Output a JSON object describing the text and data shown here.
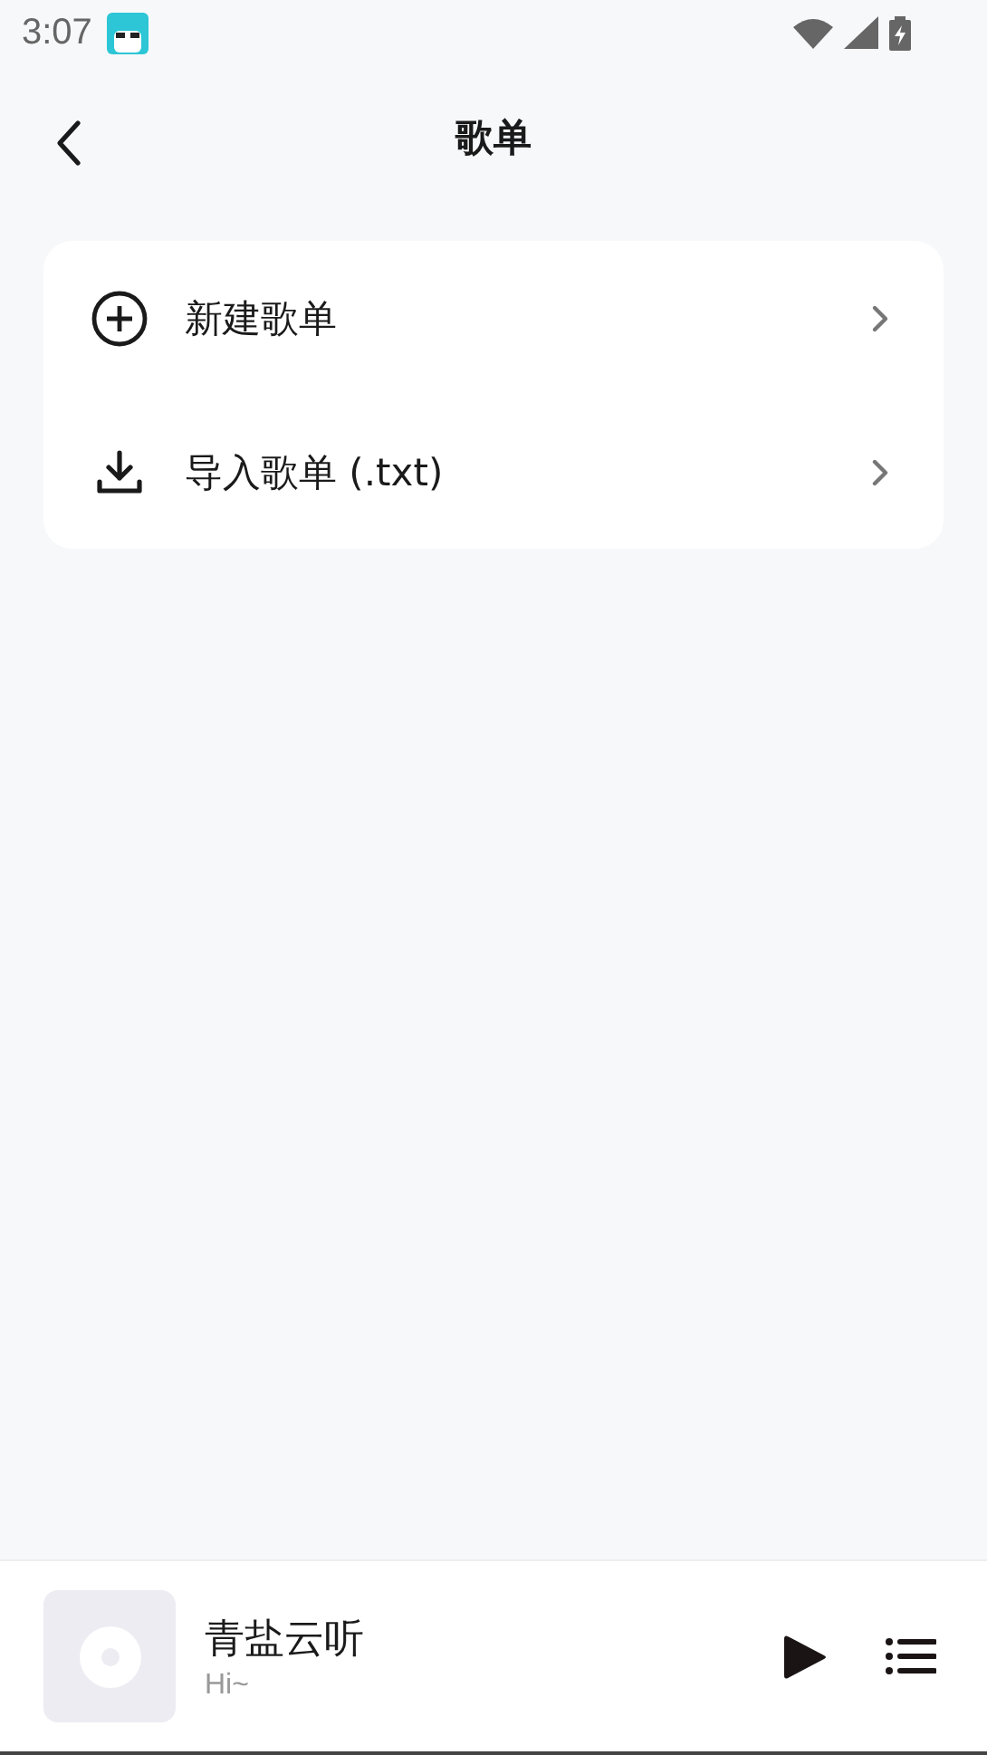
{
  "status_bar": {
    "time": "3:07"
  },
  "header": {
    "title": "歌单"
  },
  "menu": [
    {
      "kind": "add",
      "label": "新建歌单"
    },
    {
      "kind": "import",
      "label": "导入歌单 (.txt)"
    }
  ],
  "player": {
    "title": "青盐云听",
    "subtitle": "Hi~"
  }
}
